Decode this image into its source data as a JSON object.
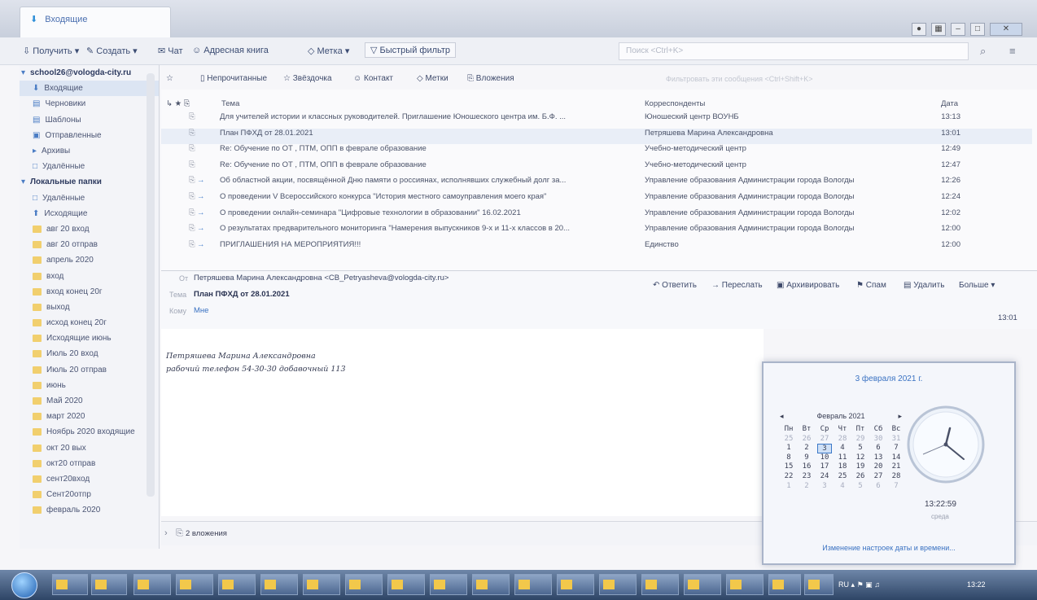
{
  "window": {
    "tab_title": "Входящие"
  },
  "toolbar": {
    "get_label": "Получить",
    "create_label": "Создать",
    "chat_label": "Чат",
    "address_book_label": "Адресная книга",
    "tags_label": "Метка",
    "quick_filter_label": "Быстрый фильтр",
    "search_placeholder": "Поиск <Ctrl+K>"
  },
  "sidebar": {
    "account": "school26@vologda-city.ru",
    "items": [
      {
        "label": "Входящие"
      },
      {
        "label": "Черновики"
      },
      {
        "label": "Шаблоны"
      },
      {
        "label": "Отправленные"
      },
      {
        "label": "Архивы"
      },
      {
        "label": "Удалённые"
      },
      {
        "label": "Локальные папки"
      },
      {
        "label": "Удалённые"
      },
      {
        "label": "Исходящие"
      },
      {
        "label": "авг 20 вход"
      },
      {
        "label": "авг 20 отправ"
      },
      {
        "label": "апрель 2020"
      },
      {
        "label": "вход"
      },
      {
        "label": "вход конец 20г"
      },
      {
        "label": "выход"
      },
      {
        "label": "исход конец 20г"
      },
      {
        "label": "Исходящие июнь"
      },
      {
        "label": "Июль 20 вход"
      },
      {
        "label": "Июль 20 отправ"
      },
      {
        "label": "июнь"
      },
      {
        "label": "Май 2020"
      },
      {
        "label": "март 2020"
      },
      {
        "label": "Ноябрь 2020 входящие"
      },
      {
        "label": "окт 20 вых"
      },
      {
        "label": "окт20 отправ"
      },
      {
        "label": "сент20вход"
      },
      {
        "label": "Сент20отпр"
      },
      {
        "label": "февраль 2020"
      }
    ]
  },
  "filters": {
    "unread": "Непрочитанные",
    "starred": "Звёздочка",
    "contact": "Контакт",
    "tags": "Метки",
    "attachments": "Вложения",
    "filter_placeholder": "Фильтровать эти сообщения <Ctrl+Shift+K>"
  },
  "messages": {
    "col_subject": "Тема",
    "col_correspondents": "Корреспонденты",
    "col_date": "Дата",
    "rows": [
      {
        "subject": "Для учителей истории и классных руководителей. Приглашение Юношеского центра им. Б.Ф. ...",
        "correspondent": "Юношеский центр ВОУНБ",
        "date": "13:13"
      },
      {
        "subject": "План ПФХД от 28.01.2021",
        "correspondent": "Петряшева Марина Александровна",
        "date": "13:01"
      },
      {
        "subject": "Re: Обучение по ОТ , ПТМ, ОПП в феврале образование",
        "correspondent": "Учебно-методический центр",
        "date": "12:49"
      },
      {
        "subject": "Re: Обучение по ОТ , ПТМ, ОПП в феврале образование",
        "correspondent": "Учебно-методический центр",
        "date": "12:47"
      },
      {
        "subject": "Об областной акции, посвящённой Дню памяти о россиянах, исполнявших служебный долг за...",
        "correspondent": "Управление образования Администрации города Вологды",
        "date": "12:26"
      },
      {
        "subject": "О проведении V Всероссийского конкурса \"История местного самоуправления моего края\"",
        "correspondent": "Управление образования Администрации города Вологды",
        "date": "12:24"
      },
      {
        "subject": "О проведении онлайн-семинара \"Цифровые технологии в образовании\" 16.02.2021",
        "correspondent": "Управление образования Администрации города Вологды",
        "date": "12:02"
      },
      {
        "subject": "О результатах предварительного мониторинга \"Намерения выпускников 9-х и 11-х классов в 20...",
        "correspondent": "Управление образования Администрации города Вологды",
        "date": "12:00"
      },
      {
        "subject": "ПРИГЛАШЕНИЯ НА МЕРОПРИЯТИЯ!!!",
        "correspondent": "Единство",
        "date": "12:00"
      }
    ]
  },
  "message_header": {
    "from_label": "От",
    "from_value": "Петряшева Марина Александровна <CB_Petryasheva@vologda-city.ru>",
    "subject_label": "Тема",
    "subject_value": "План ПФХД от 28.01.2021",
    "to_label": "Кому",
    "to_value": "Мне",
    "time": "13:01",
    "reply": "Ответить",
    "forward": "Переслать",
    "archive": "Архивировать",
    "spam": "Спам",
    "delete": "Удалить",
    "more": "Больше"
  },
  "message_body": {
    "line1": "Петряшева Марина Александровна",
    "line2": "рабочий телефон 54-30-30 добавочный 113"
  },
  "attachments_bar": {
    "label": "2 вложения"
  },
  "calendar": {
    "full_date": "3 февраля 2021 г.",
    "month": "Февраль 2021",
    "weekdays": [
      "Пн",
      "Вт",
      "Ср",
      "Чт",
      "Пт",
      "Сб",
      "Вс"
    ],
    "time": "13:22:59",
    "day_name": "среда",
    "link": "Изменение настроек даты и времени..."
  },
  "taskbar": {
    "lang": "RU",
    "clock": "13:22"
  },
  "colors": {
    "accent": "#3a72c2",
    "selected_row": "#e9eef7",
    "taskbar": "#2e4566"
  }
}
